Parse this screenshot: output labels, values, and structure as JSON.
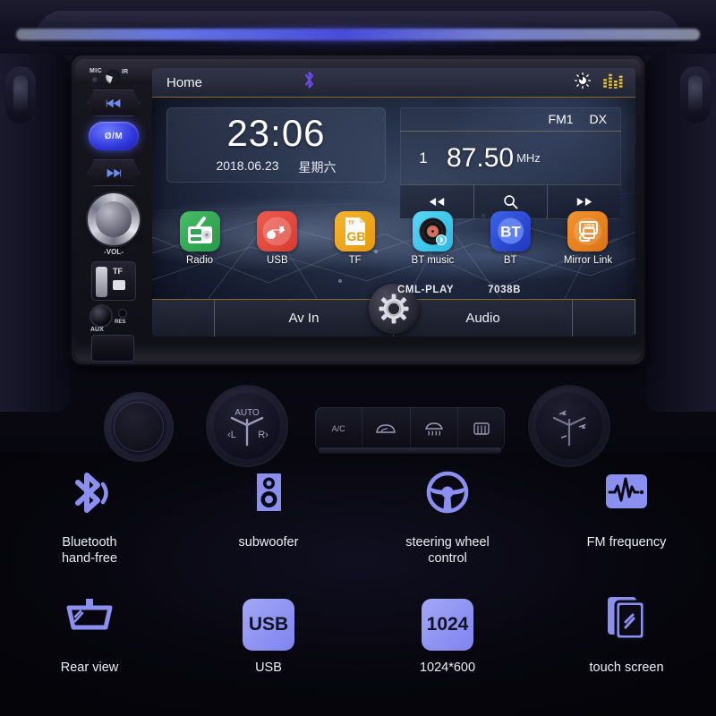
{
  "device": {
    "brand": "CML-PLAY",
    "model": "7038B"
  },
  "head_unit": {
    "left_controls": {
      "mic_label": "MIC",
      "ir_label": "IR",
      "prev_button": "prev-track",
      "power_button_label": "Ø/M",
      "next_button": "next-track",
      "volume_label": "-VOL-",
      "tf_label": "TF",
      "aux_label": "AUX",
      "reset_label": "RES"
    },
    "screen": {
      "statusbar": {
        "title": "Home",
        "bluetooth_icon": "bluetooth-icon",
        "brightness_icon": "brightness-icon",
        "equalizer_icon": "equalizer-icon"
      },
      "clock": {
        "time": "23:06",
        "date": "2018.06.23",
        "weekday": "星期六"
      },
      "radio": {
        "band": "FM1",
        "mode": "DX",
        "preset": "1",
        "frequency": "87.50",
        "unit": "MHz",
        "prev_icon": "rewind-icon",
        "search_icon": "search-icon",
        "next_icon": "fast-forward-icon"
      },
      "apps": [
        {
          "label": "Radio",
          "icon": "radio-icon",
          "color": "#34a853"
        },
        {
          "label": "USB",
          "icon": "usb-icon",
          "color": "#e8453c"
        },
        {
          "label": "TF",
          "icon": "tf-card-icon",
          "color": "#f0a81e"
        },
        {
          "label": "BT music",
          "icon": "bt-music-icon",
          "color": "#3fc8ee"
        },
        {
          "label": "BT",
          "icon": "bluetooth-icon",
          "color": "#2a4fd8"
        },
        {
          "label": "Mirror Link",
          "icon": "mirror-link-icon",
          "color": "#e8821e"
        }
      ],
      "tabs": {
        "left": "Av In",
        "right": "Audio",
        "settings_icon": "gear-icon"
      }
    }
  },
  "dashboard": {
    "play_knob": "play-pause-knob",
    "climate_knob": {
      "auto_label": "AUTO",
      "left_label": "L",
      "right_label": "R"
    },
    "climate_buttons": [
      {
        "label": "A/C",
        "icon": "ac-icon"
      },
      {
        "label": "",
        "icon": "air-recirculation-icon"
      },
      {
        "label": "",
        "icon": "front-defrost-icon"
      },
      {
        "label": "",
        "icon": "rear-defrost-icon"
      }
    ],
    "fan_knob": "fan-direction-knob"
  },
  "features": {
    "row1": [
      {
        "label": "Bluetooth\nhand-free",
        "icon": "bluetooth-handsfree-icon"
      },
      {
        "label": "subwoofer",
        "icon": "subwoofer-icon"
      },
      {
        "label": "steering wheel\ncontrol",
        "icon": "steering-wheel-icon"
      },
      {
        "label": "FM frequency",
        "icon": "fm-waveform-icon"
      }
    ],
    "row2": [
      {
        "label": "Rear view",
        "icon": "rear-view-mirror-icon"
      },
      {
        "label": "USB",
        "icon": "usb-badge-icon",
        "badge": "USB"
      },
      {
        "label": "1024*600",
        "icon": "resolution-icon",
        "badge": "1024"
      },
      {
        "label": "touch screen",
        "icon": "touch-screen-icon"
      }
    ]
  },
  "colors": {
    "accent_purple": "#8b8ff0",
    "status_bt": "#6a49e8",
    "eq_yellow": "#e8c23a",
    "divider_gold": "#8a6a27"
  }
}
